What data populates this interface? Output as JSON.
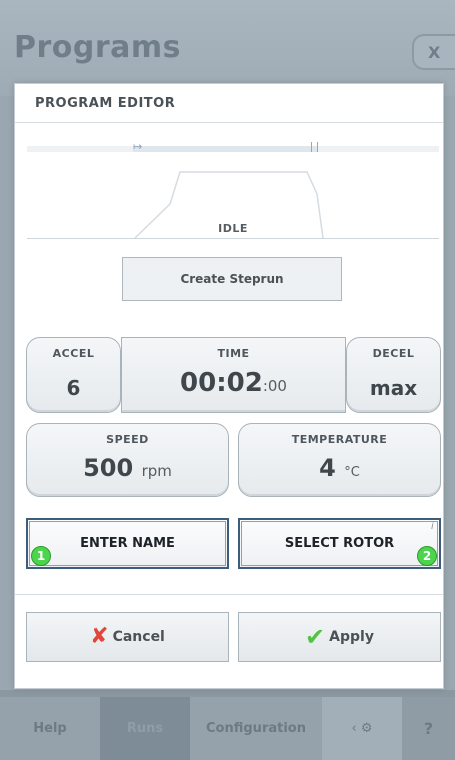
{
  "background": {
    "title": "Programs",
    "close_label": "X",
    "tabs": [
      {
        "label": "Help"
      },
      {
        "label": "Runs"
      },
      {
        "label": "Configuration"
      }
    ],
    "help_label": "?"
  },
  "dialog": {
    "title": "PROGRAM EDITOR",
    "graph_status": "IDLE",
    "create_steprun_label": "Create Steprun",
    "accel": {
      "label": "ACCEL",
      "value": "6"
    },
    "time": {
      "label": "TIME",
      "value_main": "00:02",
      "value_seconds": ":00"
    },
    "decel": {
      "label": "DECEL",
      "value": "max"
    },
    "speed": {
      "label": "SPEED",
      "value": "500",
      "unit": "rpm"
    },
    "temperature": {
      "label": "TEMPERATURE",
      "value": "4",
      "unit": "°C"
    },
    "enter_name_label": "ENTER NAME",
    "enter_name_badge": "1",
    "select_rotor_label": "SELECT ROTOR",
    "select_rotor_badge": "2",
    "select_rotor_info": "i",
    "cancel_label": "Cancel",
    "apply_label": "Apply"
  },
  "colors": {
    "accent_border": "#3e5d7c",
    "badge_green": "#4cd44c",
    "cancel_red": "#e0463b",
    "apply_green": "#56c244"
  }
}
